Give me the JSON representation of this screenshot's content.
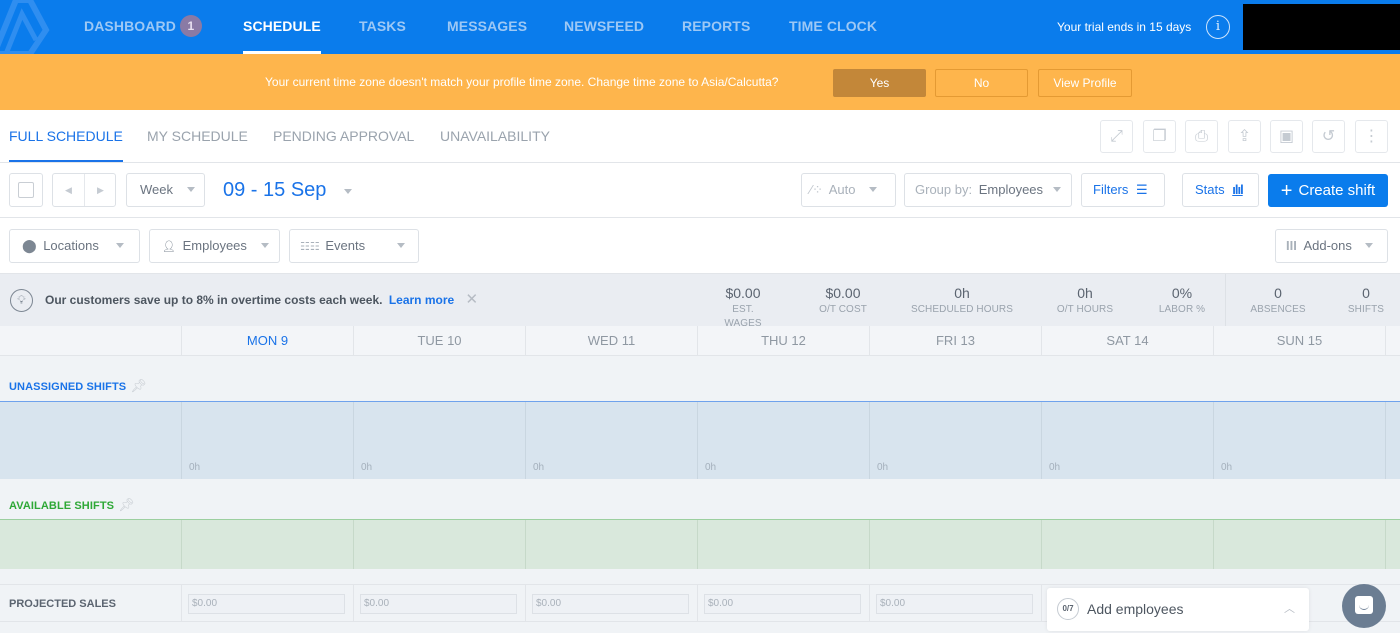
{
  "topnav": {
    "items": [
      {
        "label": "DASHBOARD",
        "badge": "1",
        "active": false
      },
      {
        "label": "SCHEDULE",
        "active": true
      },
      {
        "label": "TASKS",
        "active": false
      },
      {
        "label": "MESSAGES",
        "active": false
      },
      {
        "label": "NEWSFEED",
        "active": false
      },
      {
        "label": "REPORTS",
        "active": false
      },
      {
        "label": "TIME CLOCK",
        "active": false
      }
    ],
    "trial_text": "Your trial ends in 15 days",
    "info_icon": "info-icon"
  },
  "warning": {
    "message": "Your current time zone doesn't match your profile time zone. Change time zone to Asia/Calcutta?",
    "yes_label": "Yes",
    "no_label": "No",
    "view_profile_label": "View Profile",
    "colors": {
      "background": "#feb54c",
      "yes": "#c38739"
    }
  },
  "subtabs": {
    "items": [
      {
        "label": "FULL SCHEDULE",
        "active": true
      },
      {
        "label": "MY SCHEDULE",
        "active": false
      },
      {
        "label": "PENDING APPROVAL",
        "active": false
      },
      {
        "label": "UNAVAILABILITY",
        "active": false
      }
    ],
    "tool_icons": [
      "expand-icon",
      "copy-icon",
      "print-icon",
      "upload-icon",
      "calendar-sync-icon",
      "history-icon",
      "more-vertical-icon"
    ]
  },
  "toolbar": {
    "view_select": "Week",
    "date_range": "09 - 15 Sep",
    "auto_label": "Auto",
    "group_by_label": "Group by:",
    "group_by_value": "Employees",
    "filters_label": "Filters",
    "stats_label": "Stats",
    "create_label": "Create shift",
    "accent": "#0a7cec"
  },
  "filter_row": {
    "locations": "Locations",
    "employees": "Employees",
    "events": "Events",
    "addons": "Add-ons"
  },
  "promo": {
    "text": "Our customers save up to 8% in overtime costs each week.",
    "link": "Learn more",
    "close": "✕"
  },
  "stats": [
    {
      "value": "$0.00",
      "label": "EST. WAGES"
    },
    {
      "value": "$0.00",
      "label": "O/T COST"
    },
    {
      "value": "0h",
      "label": "SCHEDULED HOURS"
    },
    {
      "value": "0h",
      "label": "O/T HOURS"
    },
    {
      "value": "0%",
      "label": "LABOR %"
    },
    {
      "value": "0",
      "label": "ABSENCES"
    },
    {
      "value": "0",
      "label": "SHIFTS"
    }
  ],
  "days": [
    {
      "label": "MON 9",
      "today": true
    },
    {
      "label": "TUE 10",
      "today": false
    },
    {
      "label": "WED 11",
      "today": false
    },
    {
      "label": "THU 12",
      "today": false
    },
    {
      "label": "FRI 13",
      "today": false
    },
    {
      "label": "SAT 14",
      "today": false
    },
    {
      "label": "SUN 15",
      "today": false
    }
  ],
  "sections": {
    "unassigned_label": "UNASSIGNED SHIFTS",
    "unassigned_hours": [
      "0h",
      "0h",
      "0h",
      "0h",
      "0h",
      "0h",
      "0h"
    ],
    "available_label": "AVAILABLE SHIFTS",
    "projected_label": "PROJECTED SALES",
    "projected_values": [
      "$0.00",
      "$0.00",
      "$0.00",
      "$0.00",
      "$0.00"
    ],
    "colors": {
      "unassigned": "#1a73e8",
      "available": "#2ea836"
    }
  },
  "add_employees": {
    "counter": "0/7",
    "label": "Add employees"
  }
}
